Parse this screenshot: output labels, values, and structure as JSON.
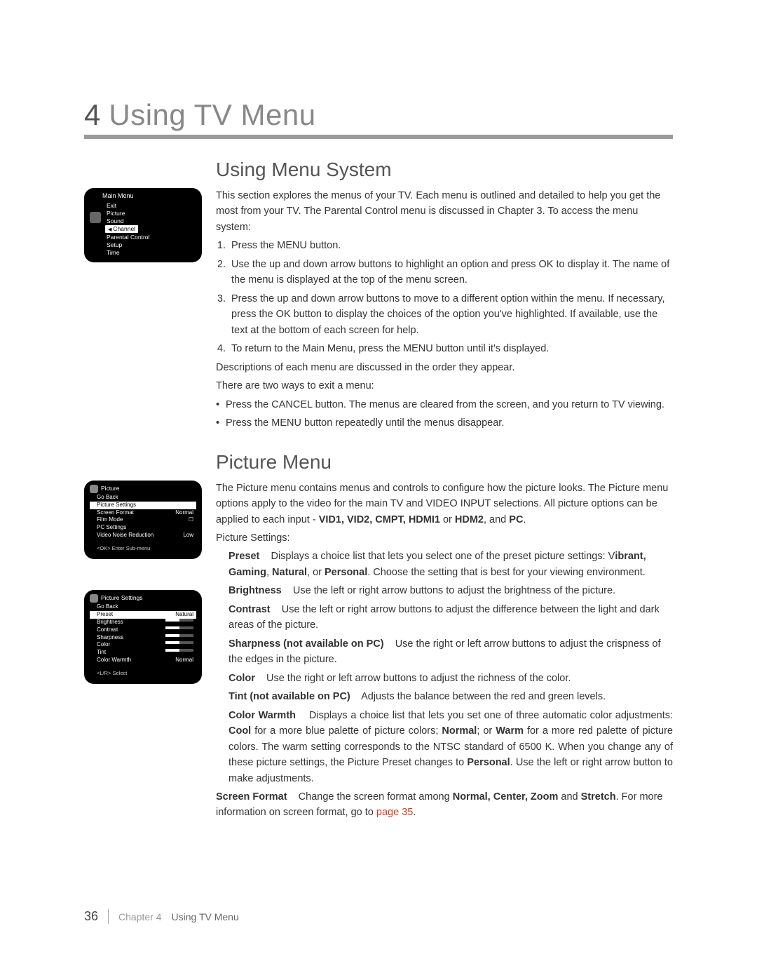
{
  "chapter": {
    "num": "4",
    "title": "Using TV Menu"
  },
  "section1": {
    "title": "Using Menu System",
    "intro": "This section explores the menus of your TV. Each menu is outlined and detailed to help you get the most from your TV. The Parental Control menu is discussed in Chapter 3. To access the menu system:",
    "step1": "Press the MENU button.",
    "step2": "Use the up and down arrow buttons to highlight an option and press OK to display it. The name of the menu is displayed at the top of the menu screen.",
    "step3": "Press the up and down arrow buttons to move to a different option within the menu. If necessary, press the OK button to display the choices of the option you've highlighted. If available, use the text at the bottom of each screen for help.",
    "step4": "To return to the Main Menu, press the MENU button until it's displayed.",
    "desc": "Descriptions of each menu are discussed in the order they appear.",
    "exit_intro": "There are two ways to exit a menu:",
    "exit1": "Press the CANCEL button. The menus are cleared from the screen, and you return to TV viewing.",
    "exit2": "Press the MENU button repeatedly until the menus disappear."
  },
  "thumb1": {
    "title": "Main Menu",
    "items": [
      "Exit",
      "Picture",
      "Sound",
      "Channel",
      "Parental Control",
      "Setup",
      "Time"
    ]
  },
  "section2": {
    "title": "Picture Menu",
    "intro_a": "The Picture menu contains menus and controls to configure how the picture looks. The Picture menu options apply to the video for the main TV and VIDEO INPUT selections. All picture options can be applied to each input - ",
    "inputs": "VID1, VID2, CMPT, HDMI1",
    "intro_b": " or ",
    "inputs2": "HDM2",
    "intro_c": ", and ",
    "inputs3": "PC",
    "intro_d": ".",
    "ps_label": "Picture Settings:",
    "preset_term": "Preset",
    "preset_a": "Displays a choice list that lets you select one of the preset picture settings: V",
    "preset_b": "ibrant, Gaming",
    "preset_c": ", ",
    "preset_d": "Natural",
    "preset_e": ", or ",
    "preset_f": "Personal",
    "preset_g": ". Choose the setting that is best for your viewing environment.",
    "bright_term": "Brightness",
    "bright": "Use the left or right arrow buttons to adjust the brightness of the picture.",
    "contrast_term": "Contrast",
    "contrast": "Use the left or right arrow buttons to adjust the difference between the light and dark areas of the picture.",
    "sharp_term": "Sharpness (not available on PC)",
    "sharp": "Use the right or left arrow buttons to adjust the crispness of the edges in the picture.",
    "color_term": "Color",
    "color": "Use the right or left arrow buttons to adjust the richness of the color.",
    "tint_term": "Tint (not available on PC)",
    "tint": "Adjusts the balance between the red and green levels.",
    "cw_term": "Color Warmth",
    "cw_a": "Displays a choice list that lets you set one of three automatic color adjustments: ",
    "cw_b": "Cool",
    "cw_c": " for a more blue palette of picture colors; ",
    "cw_d": "Normal",
    "cw_e": "; or ",
    "cw_f": "Warm",
    "cw_g": " for a more red palette of picture colors.  The warm setting corresponds to the NTSC standard of 6500 K. When you change any of these picture settings, the Picture Preset changes to ",
    "cw_h": "Personal",
    "cw_i": ". Use the left or right arrow button to make adjustments.",
    "sf_term": "Screen Format",
    "sf_a": "Change the screen format among ",
    "sf_b": "Normal, Center, Zoom",
    "sf_c": " and ",
    "sf_d": "Stretch",
    "sf_e": ". For more information on screen format, go to ",
    "sf_link": "page 35",
    "sf_f": "."
  },
  "thumb2": {
    "title": "Picture",
    "goback": "Go Back",
    "hl": "Picture Settings",
    "r1a": "Screen Format",
    "r1b": "Normal",
    "r2a": "Film Mode",
    "r2b": "☐",
    "r3a": "PC Settings",
    "r4a": "Video Noise Reduction",
    "r4b": "Low",
    "foot": "<OK> Enter Sub-menu"
  },
  "thumb3": {
    "title": "Picture Settings",
    "goback": "Go Back",
    "r1a": "Preset",
    "r1b": "Natural",
    "r2a": "Brightness",
    "r3a": "Contrast",
    "r4a": "Sharpness",
    "r5a": "Color",
    "r6a": "Tint",
    "r7a": "Color Warmth",
    "r7b": "Normal",
    "foot": "<L/R> Select"
  },
  "footer": {
    "page": "36",
    "chapter": "Chapter 4",
    "name": "Using TV Menu"
  }
}
